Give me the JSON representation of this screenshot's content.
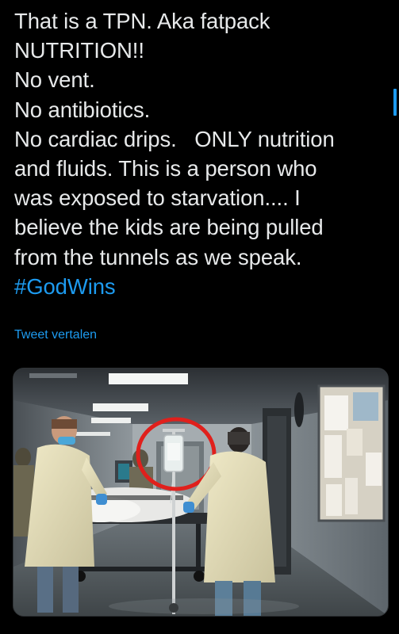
{
  "tweet": {
    "lines": [
      "That is a TPN. Aka fatpack",
      "NUTRITION!!",
      "No vent.",
      "No antibiotics.",
      "No cardiac drips.   ONLY nutrition",
      "and fluids. This is a person who",
      "was exposed to starvation.... I",
      "believe the kids are being pulled",
      "from the tunnels as we speak."
    ],
    "hashtag": "#GodWins",
    "translate_label": "Tweet vertalen"
  },
  "media": {
    "description_icon": "photo",
    "highlight_color": "#e0201c"
  },
  "colors": {
    "background": "#000000",
    "text": "#e7e9ea",
    "accent": "#1d9bf0"
  }
}
